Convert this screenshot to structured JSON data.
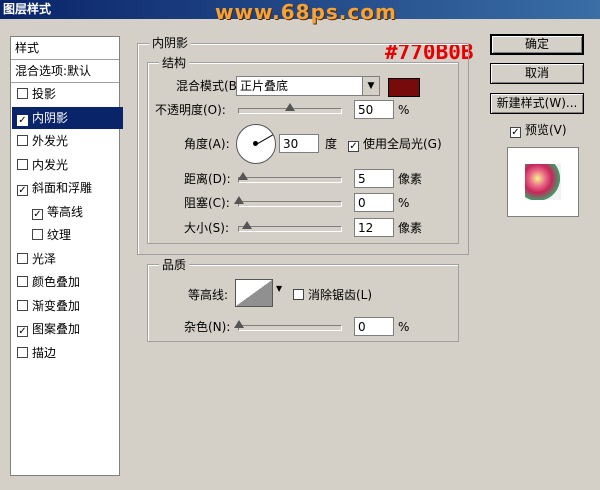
{
  "window": {
    "title": "图层样式"
  },
  "watermark": "www.68ps.com",
  "annotation": {
    "color_note": "#770B0B"
  },
  "left_list": {
    "header": "样式",
    "blend_default": "混合选项:默认",
    "items": [
      {
        "label": "投影",
        "checked": false,
        "selected": false
      },
      {
        "label": "内阴影",
        "checked": true,
        "selected": true
      },
      {
        "label": "外发光",
        "checked": false,
        "selected": false
      },
      {
        "label": "内发光",
        "checked": false,
        "selected": false
      },
      {
        "label": "斜面和浮雕",
        "checked": true,
        "selected": false
      },
      {
        "label": "等高线",
        "checked": true,
        "selected": false,
        "indent": true
      },
      {
        "label": "纹理",
        "checked": false,
        "selected": false,
        "indent": true
      },
      {
        "label": "光泽",
        "checked": false,
        "selected": false
      },
      {
        "label": "颜色叠加",
        "checked": false,
        "selected": false
      },
      {
        "label": "渐变叠加",
        "checked": false,
        "selected": false
      },
      {
        "label": "图案叠加",
        "checked": true,
        "selected": false
      },
      {
        "label": "描边",
        "checked": false,
        "selected": false
      }
    ]
  },
  "panel": {
    "title": "内阴影",
    "structure": {
      "title": "结构",
      "blend_mode_label": "混合模式(B):",
      "blend_mode_value": "正片叠底",
      "color": "#770B0B",
      "opacity_label": "不透明度(O):",
      "opacity_value": "50",
      "opacity_unit": "%",
      "opacity_level": 50,
      "angle_label": "角度(A):",
      "angle_value": "30",
      "angle_unit": "度",
      "global_light_label": "使用全局光(G)",
      "global_light_checked": true,
      "distance_label": "距离(D):",
      "distance_value": "5",
      "distance_unit": "像素",
      "choke_label": "阻塞(C):",
      "choke_value": "0",
      "choke_unit": "%",
      "size_label": "大小(S):",
      "size_value": "12",
      "size_unit": "像素"
    },
    "quality": {
      "title": "品质",
      "contour_label": "等高线:",
      "antialias_label": "消除锯齿(L)",
      "antialias_checked": false,
      "noise_label": "杂色(N):",
      "noise_value": "0",
      "noise_unit": "%"
    }
  },
  "buttons": {
    "ok": "确定",
    "cancel": "取消",
    "new_style": "新建样式(W)...",
    "preview_label": "预览(V)",
    "preview_checked": true
  }
}
